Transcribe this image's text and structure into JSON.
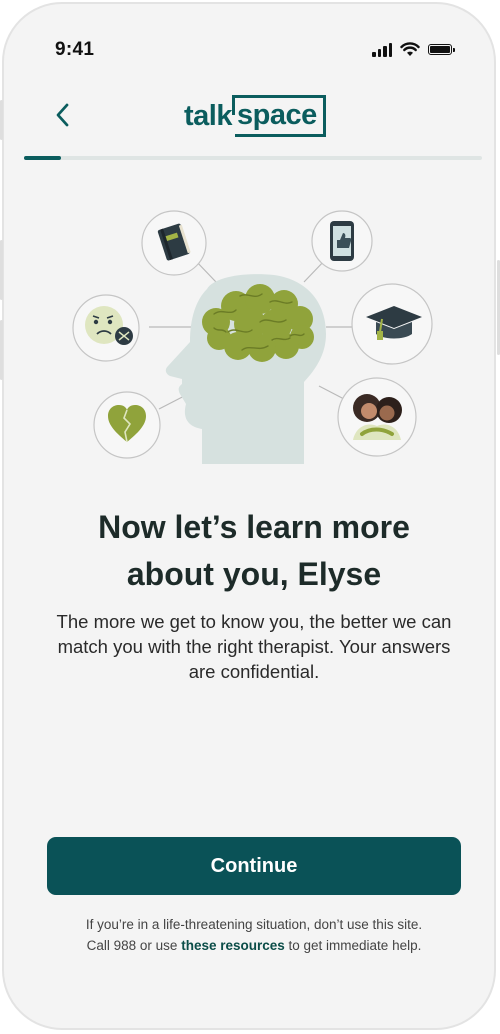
{
  "status_bar": {
    "time": "9:41",
    "icons": [
      "signal-icon",
      "wifi-icon",
      "battery-icon"
    ]
  },
  "nav": {
    "back_icon": "chevron-left-icon",
    "logo_part1": "talk",
    "logo_part2": "space"
  },
  "progress": {
    "fraction": 0.08,
    "fill_color": "#0b5d5e",
    "track_color": "#dfe5e4"
  },
  "illustration": {
    "items": [
      "book-icon",
      "phone-thumbs-up-icon",
      "sad-emoji-icon",
      "graduation-cap-icon",
      "broken-heart-icon",
      "hugging-family-icon",
      "head-brain-icon"
    ]
  },
  "main": {
    "title_line1": "Now let’s learn more",
    "title_line2": "about you, Elyse",
    "subtitle": "The more we get to know you, the better we can match you with the right therapist. Your answers are confidential."
  },
  "actions": {
    "continue_label": "Continue",
    "continue_color": "#0a5257"
  },
  "footer": {
    "line1": "If you’re in a life-threatening situation, don’t use this site.",
    "line2_prefix": "Call 988 or use ",
    "link": "these resources",
    "line2_suffix": " to get immediate help."
  }
}
